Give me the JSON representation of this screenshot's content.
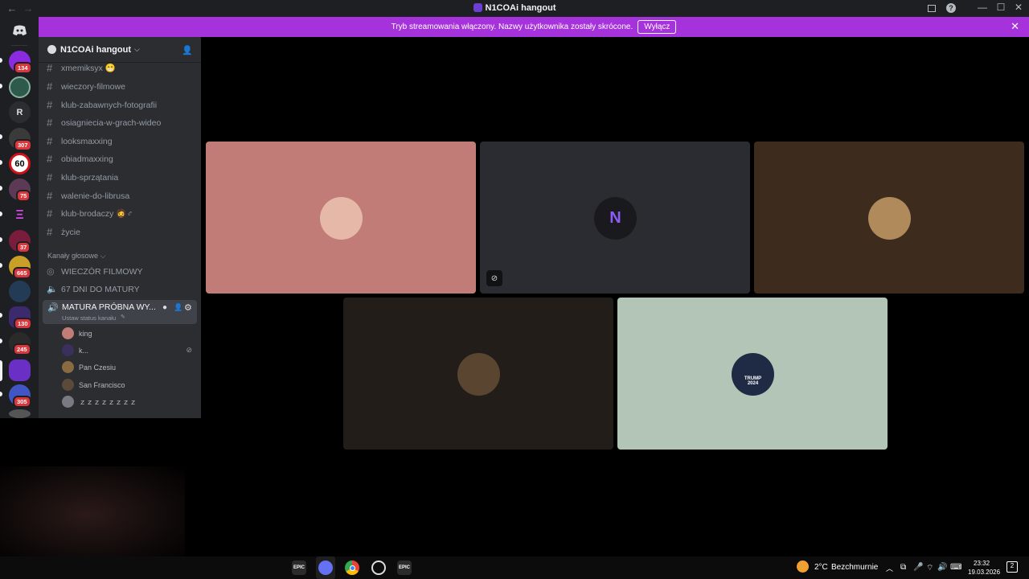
{
  "window": {
    "title": "N1COAi hangout",
    "back_icon": "←",
    "forward_icon": "→"
  },
  "banner": {
    "text": "Tryb streamowania włączony. Nazwy użytkownika zostały skrócone.",
    "button_label": "Wyłącz",
    "color": "#a632dc"
  },
  "server_rail": {
    "badges": [
      "134",
      "307",
      "75",
      "37",
      "665",
      "130",
      "245",
      "305"
    ],
    "letter_server": "R",
    "speed_sign": "60"
  },
  "sidebar": {
    "server_name": "N1COAi hangout",
    "text_channels": [
      "xmemiksyx 😁",
      "wieczory-filmowe",
      "klub-zabawnych-fotografii",
      "osiagniecia-w-grach-wideo",
      "looksmaxxing",
      "obiadmaxxing",
      "klub-sprzątania",
      "walenie-do-librusa",
      "klub-brodaczy 🧔♂",
      "życie"
    ],
    "voice_category": "Kanały głosowe",
    "voice_channels": [
      "WIECZÓR FILMOWY",
      "67 DNI DO MATURY"
    ],
    "active_voice": {
      "name": "MATURA PRÓBNA WY...",
      "status": "Ustaw status kanału"
    },
    "members": [
      "king",
      "k...",
      "Pan Czesiu",
      "San Francisco",
      "ｚｚｚｚｚｚｚｚ"
    ]
  },
  "video_tiles": [
    {
      "bg": "#c27c78",
      "muted": false
    },
    {
      "bg": "#2b2c31",
      "muted": true
    },
    {
      "bg": "#3d2b1e",
      "muted": false
    },
    {
      "bg": "#231d1a",
      "muted": false
    },
    {
      "bg": "#b3c5b6",
      "muted": false,
      "shirt_text": "TRUMP 2024"
    }
  ],
  "taskbar": {
    "weather_temp": "2°C",
    "weather_desc": "Bezchmurnie",
    "time": "23:32",
    "date": "19.03.2026",
    "notifications": "2",
    "epic_label": "EPIC"
  }
}
